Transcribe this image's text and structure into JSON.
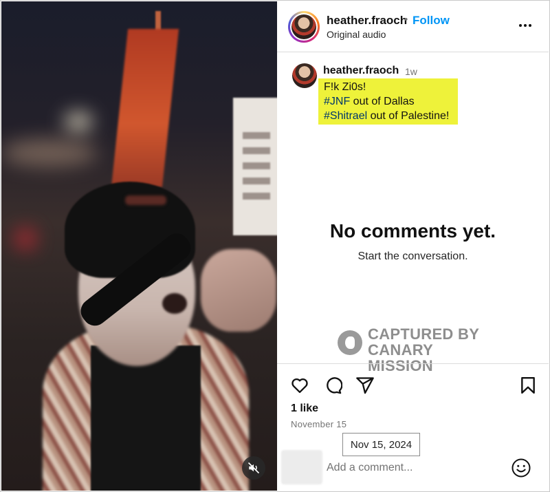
{
  "header": {
    "username": "heather.fraoch",
    "separator": "•",
    "follow_label": "Follow",
    "audio_label": "Original audio",
    "more_icon": "more-horizontal-icon"
  },
  "caption": {
    "username": "heather.fraoch",
    "time": "1w",
    "line1": "F!k Zi0s!",
    "line2_tag": "#JNF",
    "line2_rest": " out of Dallas",
    "line3_tag": "#Shitrael",
    "line3_rest": " out of Palestine!",
    "highlight_color": "#eef23a"
  },
  "empty_state": {
    "title": "No comments yet.",
    "subtitle": "Start the conversation."
  },
  "watermark": {
    "line1": "CAPTURED BY",
    "line2": "CANARY MISSION"
  },
  "actions": {
    "icons": [
      "heart-icon",
      "comment-icon",
      "share-icon",
      "bookmark-icon"
    ]
  },
  "likes": "1 like",
  "date": "November 15",
  "tooltip": "Nov 15, 2024",
  "comment": {
    "placeholder": "Add a comment...",
    "value": ""
  },
  "video": {
    "mute_icon": "muted-speaker-icon"
  },
  "colors": {
    "follow": "#0095f6",
    "hashtag": "#00376b"
  }
}
